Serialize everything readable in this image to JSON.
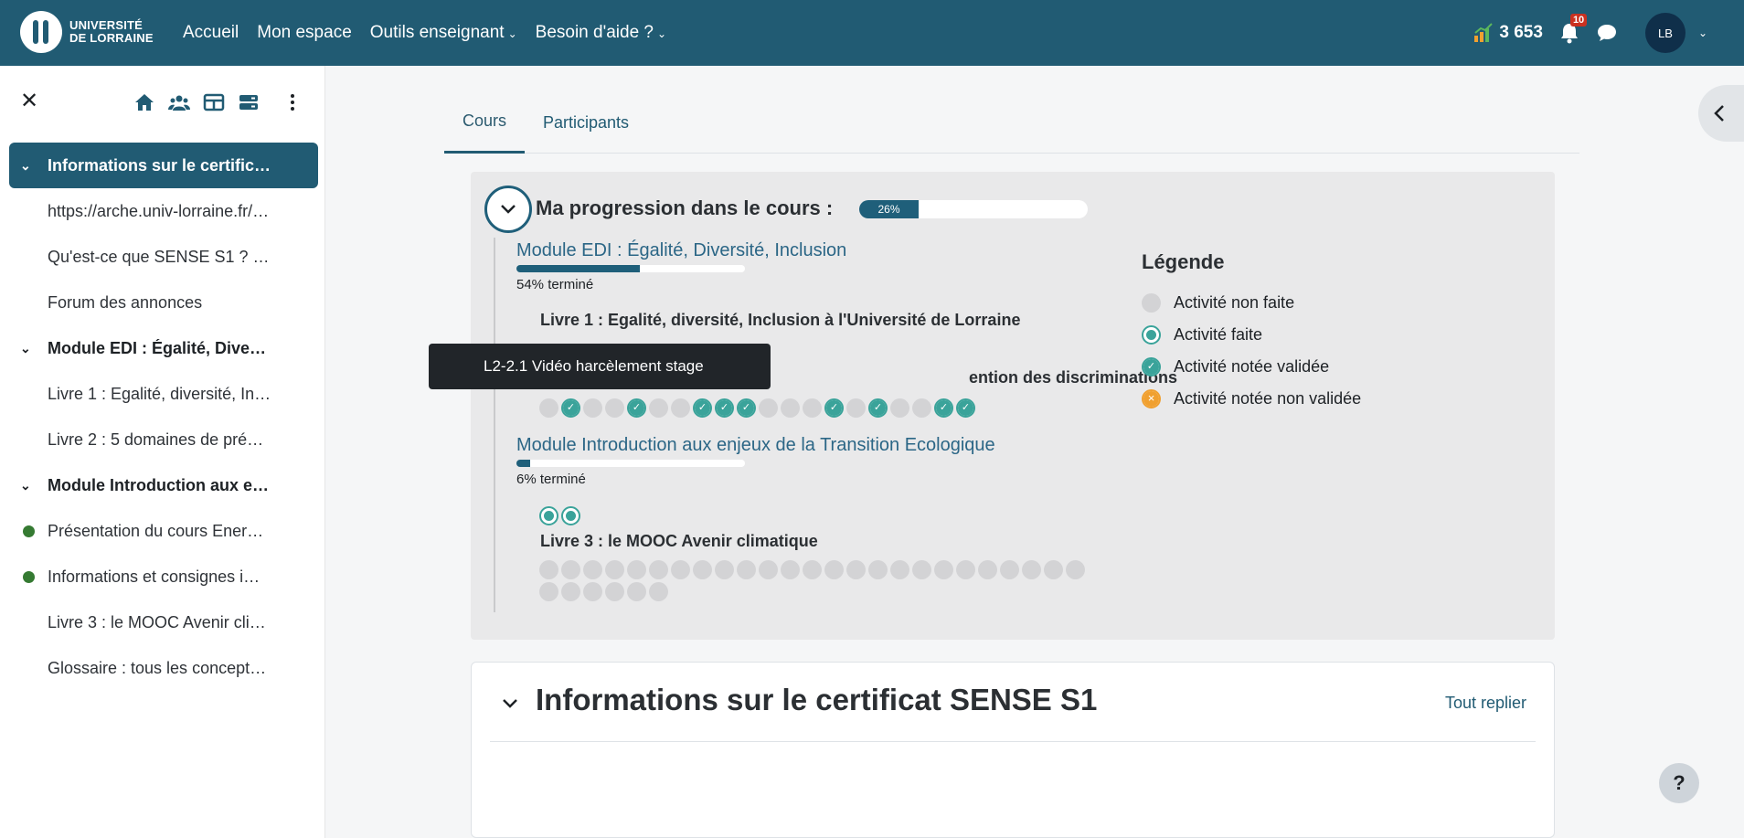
{
  "brand": {
    "line1": "UNIVERSITÉ",
    "line2": "DE LORRAINE"
  },
  "nav": {
    "items": [
      {
        "label": "Accueil",
        "dropdown": false
      },
      {
        "label": "Mon espace",
        "dropdown": false
      },
      {
        "label": "Outils enseignant",
        "dropdown": true
      },
      {
        "label": "Besoin d'aide ?",
        "dropdown": true
      }
    ],
    "stat_value": "3 653",
    "notifications_count": "10",
    "avatar_initials": "LB"
  },
  "sidebar": {
    "items": [
      {
        "type": "section",
        "label": "Informations sur le certific…",
        "active": true
      },
      {
        "type": "activity",
        "label": "https://arche.univ-lorraine.fr/…"
      },
      {
        "type": "activity",
        "label": "Qu'est-ce que SENSE S1 ? …"
      },
      {
        "type": "activity",
        "label": "Forum des annonces"
      },
      {
        "type": "section",
        "label": "Module EDI : Égalité, Dive…"
      },
      {
        "type": "activity",
        "label": "Livre 1 : Egalité, diversité, In…"
      },
      {
        "type": "activity",
        "label": "Livre 2 : 5 domaines de pré…"
      },
      {
        "type": "section",
        "label": "Module Introduction aux e…"
      },
      {
        "type": "activity",
        "label": "Présentation du cours Ener…",
        "completed": true
      },
      {
        "type": "activity",
        "label": "Informations et consignes i…",
        "completed": true
      },
      {
        "type": "activity",
        "label": "Livre 3 : le MOOC Avenir cli…"
      },
      {
        "type": "activity",
        "label": "Glossaire : tous les concept…"
      }
    ]
  },
  "tabs": [
    {
      "label": "Cours",
      "active": true
    },
    {
      "label": "Participants",
      "active": false
    }
  ],
  "progress": {
    "title": "Ma progression dans le cours :",
    "percent": 26,
    "percent_label": "26%",
    "modules": [
      {
        "title": "Module EDI : Égalité, Diversité, Inclusion",
        "percent": 54,
        "percent_label": "54% terminé",
        "book1_title": "Livre 1 : Egalité, diversité, Inclusion à l'Université de Lorraine",
        "book2_title_visible": "ention des discriminations",
        "book2_statuses": [
          "none",
          "graded",
          "none",
          "none",
          "graded",
          "none",
          "none",
          "graded",
          "graded",
          "graded",
          "none",
          "none",
          "none",
          "graded",
          "none",
          "graded",
          "none",
          "none",
          "graded",
          "graded"
        ]
      },
      {
        "title": "Module Introduction aux enjeux de la Transition Ecologique",
        "percent": 6,
        "percent_label": "6% terminé",
        "top_statuses": [
          "done",
          "done"
        ],
        "book_title": "Livre 3 : le MOOC Avenir climatique",
        "book_dot_count": 31
      }
    ]
  },
  "legend": {
    "title": "Légende",
    "items": [
      {
        "label": "Activité non faite",
        "status": "none"
      },
      {
        "label": "Activité faite",
        "status": "done"
      },
      {
        "label": "Activité notée validée",
        "status": "graded"
      },
      {
        "label": "Activité notée non validée",
        "status": "notvalid"
      }
    ]
  },
  "tooltip": {
    "text": "L2-2.1 Vidéo harcèlement stage"
  },
  "section": {
    "title": "Informations sur le certificat SENSE S1",
    "collapse_label": "Tout replier"
  },
  "help_label": "?"
}
